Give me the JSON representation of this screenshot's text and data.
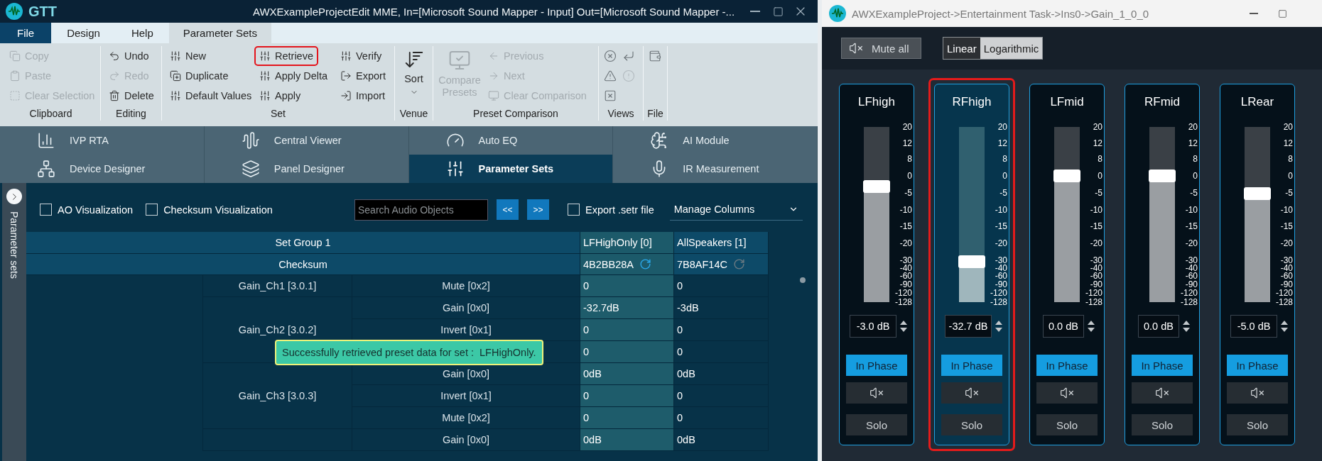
{
  "left_window": {
    "app_name": "GTT",
    "title": "AWXExampleProjectEdit MME, In=[Microsoft Sound Mapper - Input] Out=[Microsoft Sound Mapper -...",
    "menu_tabs": [
      {
        "label": "File",
        "kind": "file",
        "selected": false
      },
      {
        "label": "Design",
        "kind": "tab",
        "selected": false
      },
      {
        "label": "Help",
        "kind": "tab",
        "selected": false
      },
      {
        "label": "Parameter Sets",
        "kind": "tab",
        "selected": true
      }
    ],
    "ribbon": [
      {
        "label": "Clipboard",
        "kind": "list",
        "items": [
          {
            "label": "Copy",
            "disabled": true
          },
          {
            "label": "Paste",
            "disabled": true
          },
          {
            "label": "Clear Selection",
            "disabled": true
          }
        ]
      },
      {
        "label": "Editing",
        "kind": "list",
        "items": [
          {
            "label": "Undo",
            "disabled": false
          },
          {
            "label": "Redo",
            "disabled": true
          },
          {
            "label": "Delete",
            "disabled": false
          }
        ]
      },
      {
        "label": "Set",
        "kind": "columns",
        "items": [
          {
            "label": "New",
            "disabled": false,
            "highlighted": false
          },
          {
            "label": "Duplicate",
            "disabled": false,
            "highlighted": false
          },
          {
            "label": "Default Values",
            "disabled": false,
            "highlighted": false
          },
          {
            "label": "Retrieve",
            "disabled": false,
            "highlighted": true
          },
          {
            "label": "Apply Delta",
            "disabled": false,
            "highlighted": false
          },
          {
            "label": "Apply",
            "disabled": false,
            "highlighted": false
          },
          {
            "label": "Verify",
            "disabled": false,
            "highlighted": false
          },
          {
            "label": "Export",
            "disabled": false,
            "highlighted": false
          },
          {
            "label": "Import",
            "disabled": false,
            "highlighted": false
          }
        ]
      },
      {
        "label": "Venue",
        "kind": "large",
        "items": [
          {
            "label": "Sort",
            "disabled": false
          }
        ]
      },
      {
        "label": "Preset Comparison",
        "kind": "mixed",
        "items": [
          {
            "label": "Compare Presets",
            "disabled": true
          },
          {
            "label": "Previous",
            "disabled": true
          },
          {
            "label": "Next",
            "disabled": true
          },
          {
            "label": "Clear Comparison",
            "disabled": true
          }
        ]
      },
      {
        "label": "Views",
        "kind": "icons",
        "items": [
          {
            "disabled": false
          },
          {
            "disabled": false
          },
          {
            "disabled": false
          },
          {
            "disabled": true
          },
          {
            "disabled": false
          }
        ]
      },
      {
        "label": "File",
        "kind": "icons",
        "items": [
          {
            "disabled": false
          }
        ]
      }
    ],
    "nav_tiles": [
      {
        "label": "IVP RTA",
        "selected": false
      },
      {
        "label": "Central Viewer",
        "selected": false
      },
      {
        "label": "Auto EQ",
        "selected": false
      },
      {
        "label": "AI Module",
        "selected": false
      },
      {
        "label": "Device Designer",
        "selected": false
      },
      {
        "label": "Panel Designer",
        "selected": false
      },
      {
        "label": "Parameter Sets",
        "selected": true
      },
      {
        "label": "IR Measurement",
        "selected": false
      }
    ],
    "side_panel": {
      "label": "Parameter sets"
    },
    "toolbar": {
      "checkboxes": [
        {
          "label": "AO Visualization",
          "checked": false
        },
        {
          "label": "Checksum Visualization",
          "checked": false
        }
      ],
      "search": {
        "placeholder": "Search Audio Objects"
      },
      "nav_buttons": [
        "<<",
        ">>"
      ],
      "export": {
        "label": "Export .setr file",
        "checked": false
      },
      "columns_dropdown": "Manage Columns"
    },
    "table": {
      "group_header": "Set Group 1",
      "checksum_header": "Checksum",
      "sets": [
        {
          "name": "LFHighOnly [0]",
          "checksum": "4B2BB28A",
          "selected": true
        },
        {
          "name": "AllSpeakers [1]",
          "checksum": "7B8AF14C",
          "selected": false
        }
      ],
      "groups": [
        {
          "name": "Gain_Ch1 [3.0.1]",
          "params": [
            {
              "name": "Mute [0x2]",
              "values": [
                "0",
                "0"
              ]
            }
          ]
        },
        {
          "name": "Gain_Ch2 [3.0.2]",
          "params": [
            {
              "name": "Gain [0x0]",
              "values": [
                "-32.7dB",
                "-3dB"
              ]
            },
            {
              "name": "Invert [0x1]",
              "values": [
                "0",
                "0"
              ]
            },
            {
              "values": [
                "0",
                "0"
              ]
            }
          ]
        },
        {
          "name": "Gain_Ch3 [3.0.3]",
          "params": [
            {
              "name": "Gain [0x0]",
              "values": [
                "0dB",
                "0dB"
              ]
            },
            {
              "name": "Invert [0x1]",
              "values": [
                "0",
                "0"
              ]
            },
            {
              "name": "Mute [0x2]",
              "values": [
                "0",
                "0"
              ]
            }
          ]
        },
        {
          "params": [
            {
              "name": "Gain [0x0]",
              "values": [
                "0dB",
                "0dB"
              ]
            }
          ]
        }
      ]
    },
    "toast": {
      "text": "Successfully retrieved preset data for set :  LFHighOnly."
    }
  },
  "right_window": {
    "title": "AWXExampleProject->Entertainment Task->Ins0->Gain_1_0_0",
    "mute_all": {
      "label": "Mute all"
    },
    "scale_toggle": [
      {
        "label": "Linear",
        "selected": true
      },
      {
        "label": "Logarithmic",
        "selected": false
      }
    ],
    "channels": [
      {
        "name": "LFhigh",
        "level": 0.66,
        "value": "-3.0 dB",
        "phase": "In Phase",
        "solo": "Solo",
        "selected": false,
        "highlighted": false,
        "scale": [
          "20",
          "12",
          "8",
          "0",
          "-5",
          "-10",
          "-15",
          "-20",
          "-30",
          "-40",
          "-60",
          "-90",
          "-120",
          "-128"
        ]
      },
      {
        "name": "RFhigh",
        "level": 0.23,
        "value": "-32.7 dB",
        "phase": "In Phase",
        "solo": "Solo",
        "selected": true,
        "highlighted": true,
        "scale": [
          "20",
          "12",
          "8",
          "0",
          "-5",
          "-10",
          "-15",
          "-20",
          "-30",
          "-40",
          "-60",
          "-90",
          "-120",
          "-128"
        ]
      },
      {
        "name": "LFmid",
        "level": 0.72,
        "value": "0.0 dB",
        "phase": "In Phase",
        "solo": "Solo",
        "selected": false,
        "highlighted": false,
        "scale": [
          "20",
          "12",
          "8",
          "0",
          "-5",
          "-10",
          "-15",
          "-20",
          "-30",
          "-40",
          "-60",
          "-90",
          "-120",
          "-128"
        ]
      },
      {
        "name": "RFmid",
        "level": 0.72,
        "value": "0.0 dB",
        "phase": "In Phase",
        "solo": "Solo",
        "selected": false,
        "highlighted": false,
        "scale": [
          "20",
          "12",
          "8",
          "0",
          "-5",
          "-10",
          "-15",
          "-20",
          "-30",
          "-40",
          "-60",
          "-90",
          "-120",
          "-128"
        ]
      },
      {
        "name": "LRear",
        "level": 0.62,
        "value": "-5.0 dB",
        "phase": "In Phase",
        "solo": "Solo",
        "selected": false,
        "highlighted": false,
        "scale": [
          "20",
          "12",
          "8",
          "0",
          "-5",
          "-10",
          "-15",
          "-20",
          "-30",
          "-40",
          "-60",
          "-90",
          "-120",
          "-128"
        ]
      }
    ]
  }
}
